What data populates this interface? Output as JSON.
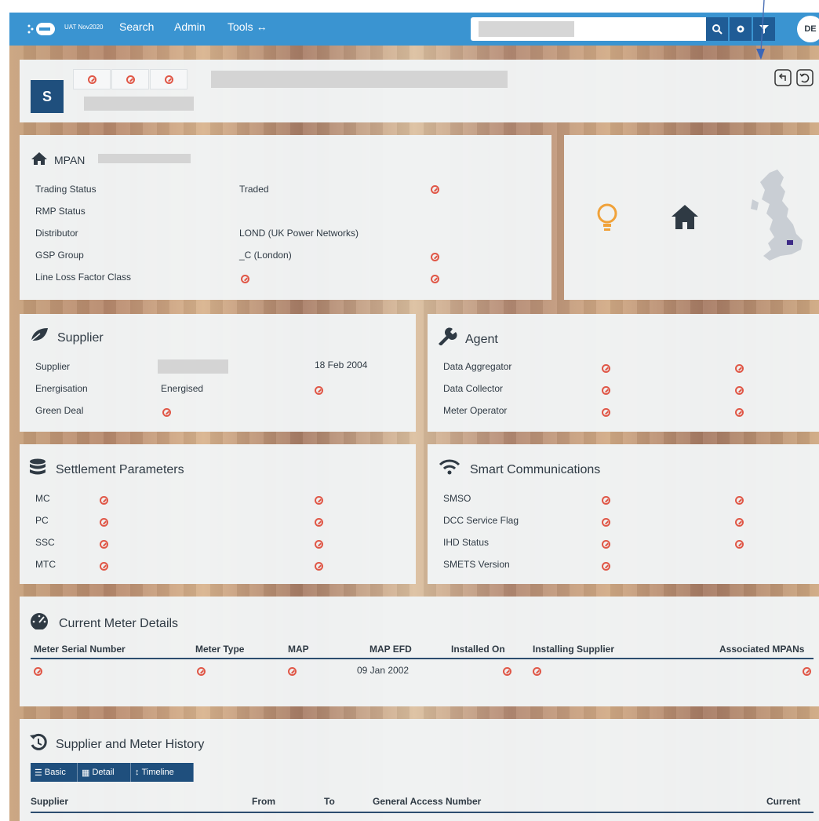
{
  "topbar": {
    "env": "UAT Nov2020",
    "nav": [
      "Search",
      "Admin",
      "Tools ↔"
    ],
    "user_initials": "DE"
  },
  "header": {
    "badge": "S"
  },
  "mpan": {
    "title": "MPAN",
    "rows": [
      {
        "label": "Trading Status",
        "value": "Traded"
      },
      {
        "label": "RMP Status",
        "value": ""
      },
      {
        "label": "Distributor",
        "value": "LOND (UK Power Networks)"
      },
      {
        "label": "GSP Group",
        "value": "_C (London)"
      },
      {
        "label": "Line Loss Factor Class",
        "value": ""
      }
    ]
  },
  "supplier": {
    "title": "Supplier",
    "rows": [
      {
        "label": "Supplier",
        "value": "",
        "date": "18 Feb 2004"
      },
      {
        "label": "Energisation",
        "value": "Energised"
      },
      {
        "label": "Green Deal",
        "value": ""
      }
    ]
  },
  "agent": {
    "title": "Agent",
    "rows": [
      "Data Aggregator",
      "Data Collector",
      "Meter Operator"
    ]
  },
  "settlement": {
    "title": "Settlement Parameters",
    "rows": [
      "MC",
      "PC",
      "SSC",
      "MTC"
    ]
  },
  "smart": {
    "title": "Smart Communications",
    "rows": [
      "SMSO",
      "DCC Service Flag",
      "IHD Status",
      "SMETS Version"
    ]
  },
  "meter": {
    "title": "Current Meter Details",
    "columns": [
      "Meter Serial Number",
      "Meter Type",
      "MAP",
      "MAP EFD",
      "Installed On",
      "Installing Supplier",
      "Associated MPANs"
    ],
    "row": {
      "map_efd": "09 Jan 2002"
    }
  },
  "history": {
    "title": "Supplier and Meter History",
    "tabs": [
      "Basic",
      "Detail",
      "Timeline"
    ],
    "columns": [
      "Supplier",
      "From",
      "To",
      "General Access Number",
      "Current"
    ]
  },
  "colors": {
    "topbar": "#3a94d1",
    "dark_button": "#1f4f7d",
    "not_available": "#e05747",
    "bulb": "#f0a23a",
    "map_marker": "#3d2a86"
  }
}
